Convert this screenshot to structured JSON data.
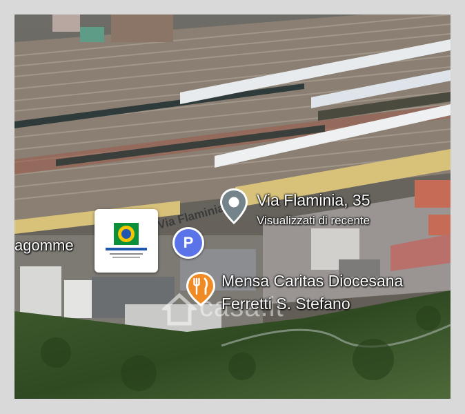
{
  "map": {
    "type": "satellite",
    "pins": {
      "location": {
        "title": "Via Flaminia, 35",
        "subtitle": "Visualizzati di recente",
        "icon": "location-pin-icon",
        "color": "#75848a"
      },
      "parking": {
        "glyph": "P",
        "icon": "parking-icon",
        "color": "#5b73e8"
      },
      "restaurant": {
        "line1": "Mensa Caritas Diocesana",
        "line2": "Ferretti S. Stefano",
        "icon": "fork-knife-icon",
        "color": "#f08a24"
      }
    },
    "road_label": "Via Flaminia",
    "partial_label": "agomme",
    "business_logo": "business-logo-icon",
    "watermark": {
      "text": "casa.it",
      "icon": "house-icon"
    }
  }
}
